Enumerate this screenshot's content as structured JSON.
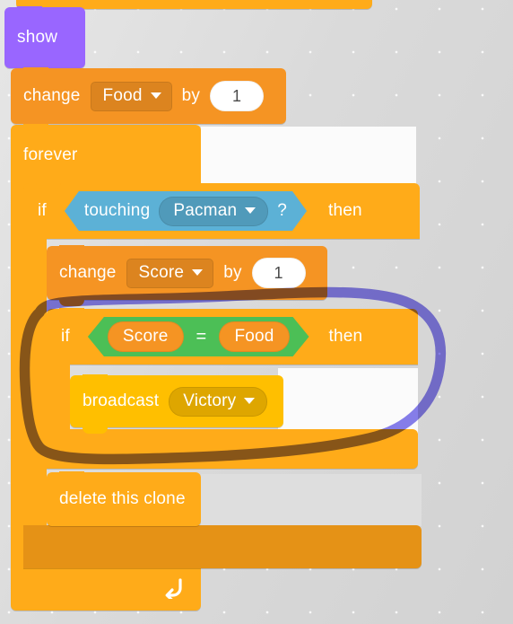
{
  "editor": {
    "app": "scratch-block-editor",
    "background_color": "#dcdcdc"
  },
  "palette_colors": {
    "looks": "#9966FF",
    "variables": "#F59423",
    "control": "#FFAB19",
    "control_shade": "#E59216",
    "sensing": "#5CB1D6",
    "operators": "#4CBF56",
    "events": "#FFBF00",
    "annotation": "#6C63E8"
  },
  "script": {
    "partial_top_block": {
      "label": ""
    },
    "blocks": [
      {
        "id": "show",
        "category": "looks",
        "label": "show"
      },
      {
        "id": "change-food",
        "category": "variables",
        "label": "change",
        "variable": "Food",
        "connector": "by",
        "value": "1"
      },
      {
        "id": "forever",
        "category": "control",
        "label": "forever"
      },
      {
        "id": "if-touching",
        "category": "control",
        "label": "if",
        "then_label": "then",
        "condition": {
          "category": "sensing",
          "label": "touching",
          "target": "Pacman",
          "suffix": "?"
        }
      },
      {
        "id": "change-score",
        "category": "variables",
        "label": "change",
        "variable": "Score",
        "connector": "by",
        "value": "1"
      },
      {
        "id": "if-score-equals-food",
        "category": "control",
        "label": "if",
        "then_label": "then",
        "condition": {
          "category": "operators",
          "operator": "=",
          "left": "Score",
          "right": "Food"
        }
      },
      {
        "id": "broadcast-victory",
        "category": "events",
        "label": "broadcast",
        "message": "Victory"
      },
      {
        "id": "delete-this-clone",
        "category": "control",
        "label": "delete this clone"
      }
    ],
    "loop_arrow_icon": "loop-arrow-icon"
  },
  "annotation": {
    "type": "freehand-ellipse",
    "color": "#6C63E8",
    "stroke_width": 11,
    "encircles": "if Score = Food then / broadcast Victory"
  }
}
